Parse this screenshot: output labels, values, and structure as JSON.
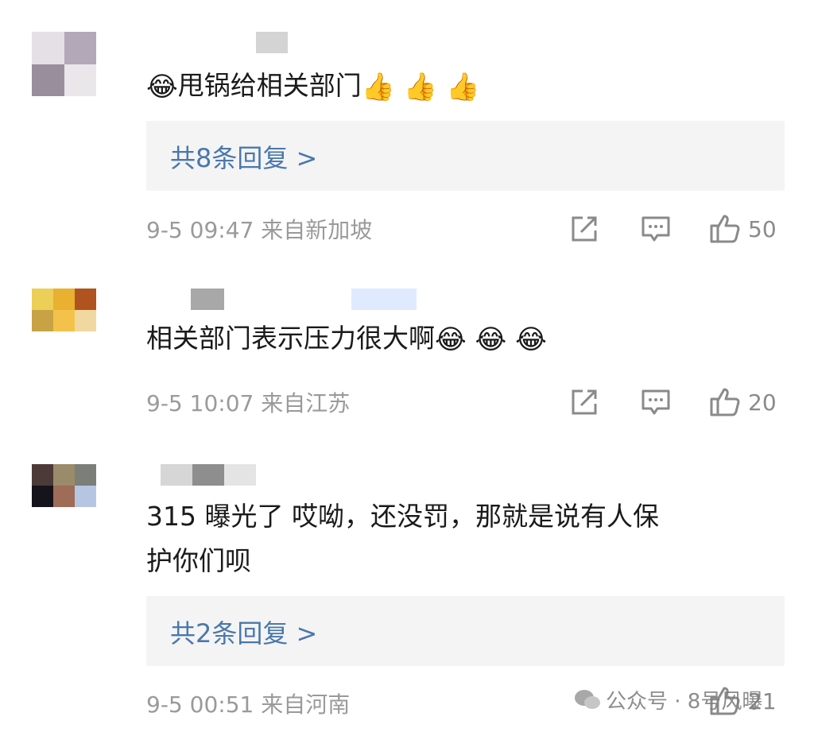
{
  "comments": [
    {
      "text": "甩锅给相关部门",
      "lead_emoji": "😂",
      "trail_emoji": "👍 👍 👍",
      "reply_label": "共8条回复 >",
      "meta": "9-5 09:47 来自新加坡",
      "likes": "50"
    },
    {
      "text": "相关部门表示压力很大啊",
      "trail_emoji": "😂 😂 😂",
      "meta": "9-5 10:07 来自江苏",
      "likes": "20"
    },
    {
      "text_line1": "315 曝光了 哎呦，还没罚，那就是说有人保",
      "text_line2": "护你们呗",
      "reply_label": "共2条回复 >",
      "meta": "9-5 00:51 来自河南",
      "likes": "21"
    }
  ],
  "watermark": "公众号 · 8号风曝",
  "icons": [
    "share-icon",
    "comment-icon",
    "thumbs-up-icon",
    "wechat-icon"
  ]
}
